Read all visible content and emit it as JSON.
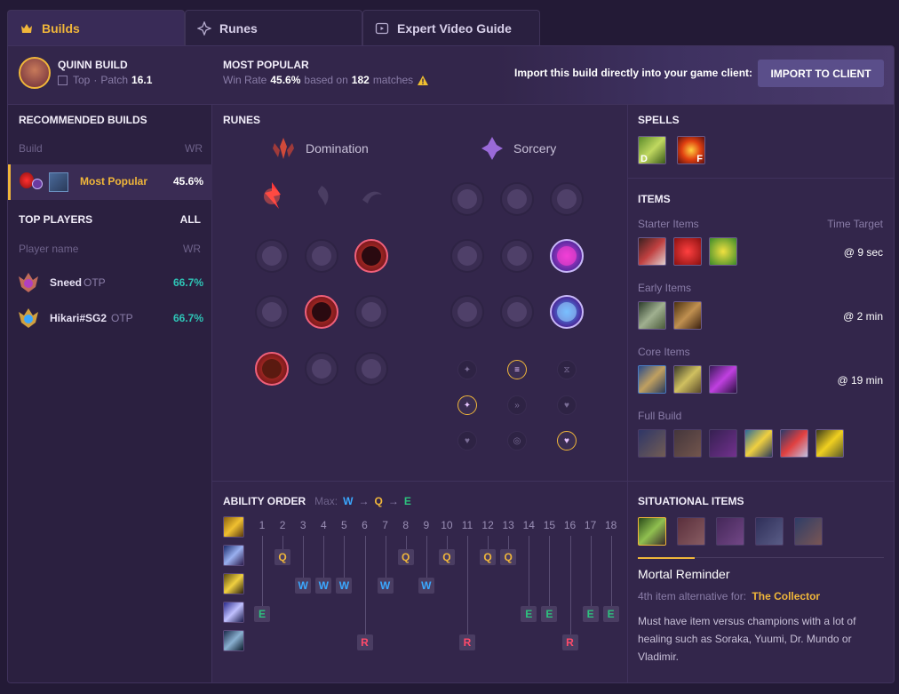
{
  "tabs": [
    {
      "label": "Builds",
      "icon": "crown-icon"
    },
    {
      "label": "Runes",
      "icon": "sparkle-icon"
    },
    {
      "label": "Expert Video Guide",
      "icon": "video-icon"
    }
  ],
  "header": {
    "champ_title": "QUINN BUILD",
    "role": "Top",
    "patch_label": "Patch",
    "patch": "16.1",
    "mp_title": "MOST POPULAR",
    "winrate_label": "Win Rate",
    "winrate": "45.6%",
    "based_label": "based on",
    "matches": "182",
    "matches_label": "matches",
    "import_text": "Import this build directly into your game client:",
    "import_button": "IMPORT TO CLIENT"
  },
  "left": {
    "rec_title": "RECOMMENDED BUILDS",
    "col_build": "Build",
    "col_wr": "WR",
    "builds": [
      {
        "name": "Most Popular",
        "wr": "45.6%"
      }
    ],
    "top_title": "TOP PLAYERS",
    "top_all": "ALL",
    "col_player": "Player name",
    "players": [
      {
        "name": "Sneed",
        "tag": "OTP",
        "wr": "66.7%"
      },
      {
        "name": "Hikari#SG2",
        "tag": "OTP",
        "wr": "66.7%"
      }
    ]
  },
  "runes": {
    "title": "RUNES",
    "primary": "Domination",
    "secondary": "Sorcery"
  },
  "spells": {
    "title": "SPELLS",
    "keys": [
      "D",
      "F"
    ]
  },
  "items": {
    "title": "ITEMS",
    "time_target": "Time Target",
    "groups": [
      {
        "label": "Starter Items",
        "time": "@ 9 sec"
      },
      {
        "label": "Early Items",
        "time": "@ 2 min"
      },
      {
        "label": "Core Items",
        "time": "@ 19 min"
      },
      {
        "label": "Full Build",
        "time": ""
      }
    ]
  },
  "ability": {
    "title": "ABILITY ORDER",
    "max_label": "Max:",
    "max_order": [
      "W",
      "Q",
      "E"
    ],
    "arrow": "→",
    "levels": [
      "1",
      "2",
      "3",
      "4",
      "5",
      "6",
      "7",
      "8",
      "9",
      "10",
      "11",
      "12",
      "13",
      "14",
      "15",
      "16",
      "17",
      "18"
    ],
    "sequence": [
      "E",
      "Q",
      "W",
      "W",
      "W",
      "R",
      "W",
      "Q",
      "W",
      "Q",
      "R",
      "Q",
      "Q",
      "E",
      "E",
      "R",
      "E",
      "E"
    ]
  },
  "situational": {
    "title": "SITUATIONAL ITEMS",
    "item_name": "Mortal Reminder",
    "alt_label": "4th item alternative for:",
    "alt_item": "The Collector",
    "description": "Must have item versus champions with a lot of healing such as Soraka, Yuumi, Dr. Mundo or Vladimir."
  },
  "colors": {
    "accent": "#f0b63a",
    "win": "#2ec4b6",
    "q": "#f0b63a",
    "w": "#3aa8ff",
    "e": "#2ec27e",
    "r": "#ff4a6a"
  }
}
